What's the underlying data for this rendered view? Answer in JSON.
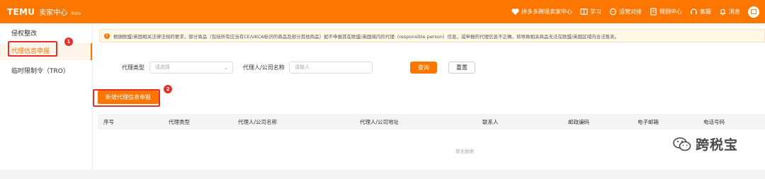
{
  "header": {
    "logo": "TEMU",
    "subtitle": "卖家中心",
    "beta": "Beta",
    "nav": [
      {
        "icon": "cross-border-icon",
        "label": "拼多多跨境卖家中心"
      },
      {
        "icon": "book-icon",
        "label": "学习"
      },
      {
        "icon": "chat-icon",
        "label": "运营对接"
      },
      {
        "icon": "document-icon",
        "label": "规则中心"
      },
      {
        "icon": "headset-icon",
        "label": "客服"
      },
      {
        "icon": "bell-icon",
        "label": "消息"
      }
    ]
  },
  "sidebar": {
    "items": [
      {
        "label": "侵权整改"
      },
      {
        "label": "代理信息申报"
      },
      {
        "label": "临时限制令（TRO）"
      }
    ]
  },
  "annotations": {
    "badge1": "1",
    "badge2": "2"
  },
  "notice": {
    "text": "根据欧盟/英国相关法律法规的要求，部分商品（包括所有应当有CE/UKCA标识的商品及部分其他商品）如不申报其在欧盟/英国境内的代理（responsible person）信息，或申报的代理信息不正确，将导致相关商品无法在欧盟/英国区域内合法售卖。"
  },
  "filter": {
    "type_label": "代理类型",
    "type_placeholder": "请选择",
    "name_label": "代理人/公司名称",
    "name_placeholder": "请输入",
    "query_label": "查询",
    "reset_label": "重置"
  },
  "actions": {
    "add_label": "新增代理信息申报"
  },
  "table": {
    "columns": [
      "序号",
      "代理类型",
      "代理人/公司名称",
      "代理人/公司地址",
      "联系人",
      "邮政编码",
      "电子邮箱",
      "电话号码"
    ],
    "empty_text": "暂无数据"
  },
  "watermark": {
    "text": "跨税宝"
  },
  "colors": {
    "brand": "#fb7701",
    "annotation": "#e8302b"
  }
}
